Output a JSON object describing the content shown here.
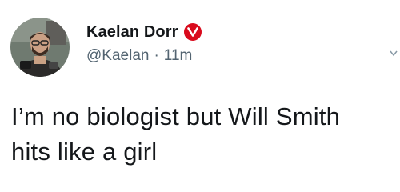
{
  "tweet": {
    "author": {
      "display_name": "Kaelan Dorr",
      "verified_icon": "verified-v-badge-icon",
      "badge_color": "#d90a1c",
      "handle": "@Kaelan",
      "separator": "·",
      "timestamp": "11m",
      "avatar_icon": "profile-photo-avatar"
    },
    "text_line_1": "I’m no biologist but Will Smith",
    "text_line_2": "hits like a girl"
  }
}
